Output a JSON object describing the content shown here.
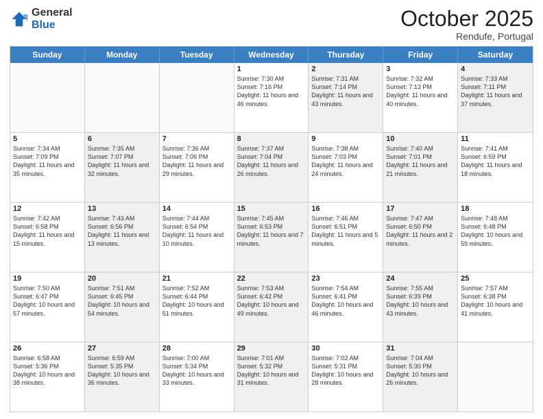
{
  "header": {
    "logo_general": "General",
    "logo_blue": "Blue",
    "month": "October 2025",
    "location": "Rendufe, Portugal"
  },
  "days_of_week": [
    "Sunday",
    "Monday",
    "Tuesday",
    "Wednesday",
    "Thursday",
    "Friday",
    "Saturday"
  ],
  "weeks": [
    [
      {
        "day": "",
        "text": "",
        "shaded": false,
        "empty": true
      },
      {
        "day": "",
        "text": "",
        "shaded": false,
        "empty": true
      },
      {
        "day": "",
        "text": "",
        "shaded": false,
        "empty": true
      },
      {
        "day": "1",
        "text": "Sunrise: 7:30 AM\nSunset: 7:16 PM\nDaylight: 11 hours and 46 minutes.",
        "shaded": false,
        "empty": false
      },
      {
        "day": "2",
        "text": "Sunrise: 7:31 AM\nSunset: 7:14 PM\nDaylight: 11 hours and 43 minutes.",
        "shaded": true,
        "empty": false
      },
      {
        "day": "3",
        "text": "Sunrise: 7:32 AM\nSunset: 7:13 PM\nDaylight: 11 hours and 40 minutes.",
        "shaded": false,
        "empty": false
      },
      {
        "day": "4",
        "text": "Sunrise: 7:33 AM\nSunset: 7:11 PM\nDaylight: 11 hours and 37 minutes.",
        "shaded": true,
        "empty": false
      }
    ],
    [
      {
        "day": "5",
        "text": "Sunrise: 7:34 AM\nSunset: 7:09 PM\nDaylight: 11 hours and 35 minutes.",
        "shaded": false,
        "empty": false
      },
      {
        "day": "6",
        "text": "Sunrise: 7:35 AM\nSunset: 7:07 PM\nDaylight: 11 hours and 32 minutes.",
        "shaded": true,
        "empty": false
      },
      {
        "day": "7",
        "text": "Sunrise: 7:36 AM\nSunset: 7:06 PM\nDaylight: 11 hours and 29 minutes.",
        "shaded": false,
        "empty": false
      },
      {
        "day": "8",
        "text": "Sunrise: 7:37 AM\nSunset: 7:04 PM\nDaylight: 11 hours and 26 minutes.",
        "shaded": true,
        "empty": false
      },
      {
        "day": "9",
        "text": "Sunrise: 7:38 AM\nSunset: 7:03 PM\nDaylight: 11 hours and 24 minutes.",
        "shaded": false,
        "empty": false
      },
      {
        "day": "10",
        "text": "Sunrise: 7:40 AM\nSunset: 7:01 PM\nDaylight: 11 hours and 21 minutes.",
        "shaded": true,
        "empty": false
      },
      {
        "day": "11",
        "text": "Sunrise: 7:41 AM\nSunset: 6:59 PM\nDaylight: 11 hours and 18 minutes.",
        "shaded": false,
        "empty": false
      }
    ],
    [
      {
        "day": "12",
        "text": "Sunrise: 7:42 AM\nSunset: 6:58 PM\nDaylight: 11 hours and 15 minutes.",
        "shaded": false,
        "empty": false
      },
      {
        "day": "13",
        "text": "Sunrise: 7:43 AM\nSunset: 6:56 PM\nDaylight: 11 hours and 13 minutes.",
        "shaded": true,
        "empty": false
      },
      {
        "day": "14",
        "text": "Sunrise: 7:44 AM\nSunset: 6:54 PM\nDaylight: 11 hours and 10 minutes.",
        "shaded": false,
        "empty": false
      },
      {
        "day": "15",
        "text": "Sunrise: 7:45 AM\nSunset: 6:53 PM\nDaylight: 11 hours and 7 minutes.",
        "shaded": true,
        "empty": false
      },
      {
        "day": "16",
        "text": "Sunrise: 7:46 AM\nSunset: 6:51 PM\nDaylight: 11 hours and 5 minutes.",
        "shaded": false,
        "empty": false
      },
      {
        "day": "17",
        "text": "Sunrise: 7:47 AM\nSunset: 6:50 PM\nDaylight: 11 hours and 2 minutes.",
        "shaded": true,
        "empty": false
      },
      {
        "day": "18",
        "text": "Sunrise: 7:48 AM\nSunset: 6:48 PM\nDaylight: 10 hours and 59 minutes.",
        "shaded": false,
        "empty": false
      }
    ],
    [
      {
        "day": "19",
        "text": "Sunrise: 7:50 AM\nSunset: 6:47 PM\nDaylight: 10 hours and 57 minutes.",
        "shaded": false,
        "empty": false
      },
      {
        "day": "20",
        "text": "Sunrise: 7:51 AM\nSunset: 6:45 PM\nDaylight: 10 hours and 54 minutes.",
        "shaded": true,
        "empty": false
      },
      {
        "day": "21",
        "text": "Sunrise: 7:52 AM\nSunset: 6:44 PM\nDaylight: 10 hours and 51 minutes.",
        "shaded": false,
        "empty": false
      },
      {
        "day": "22",
        "text": "Sunrise: 7:53 AM\nSunset: 6:42 PM\nDaylight: 10 hours and 49 minutes.",
        "shaded": true,
        "empty": false
      },
      {
        "day": "23",
        "text": "Sunrise: 7:54 AM\nSunset: 6:41 PM\nDaylight: 10 hours and 46 minutes.",
        "shaded": false,
        "empty": false
      },
      {
        "day": "24",
        "text": "Sunrise: 7:55 AM\nSunset: 6:39 PM\nDaylight: 10 hours and 43 minutes.",
        "shaded": true,
        "empty": false
      },
      {
        "day": "25",
        "text": "Sunrise: 7:57 AM\nSunset: 6:38 PM\nDaylight: 10 hours and 41 minutes.",
        "shaded": false,
        "empty": false
      }
    ],
    [
      {
        "day": "26",
        "text": "Sunrise: 6:58 AM\nSunset: 5:36 PM\nDaylight: 10 hours and 38 minutes.",
        "shaded": false,
        "empty": false
      },
      {
        "day": "27",
        "text": "Sunrise: 6:59 AM\nSunset: 5:35 PM\nDaylight: 10 hours and 36 minutes.",
        "shaded": true,
        "empty": false
      },
      {
        "day": "28",
        "text": "Sunrise: 7:00 AM\nSunset: 5:34 PM\nDaylight: 10 hours and 33 minutes.",
        "shaded": false,
        "empty": false
      },
      {
        "day": "29",
        "text": "Sunrise: 7:01 AM\nSunset: 5:32 PM\nDaylight: 10 hours and 31 minutes.",
        "shaded": true,
        "empty": false
      },
      {
        "day": "30",
        "text": "Sunrise: 7:02 AM\nSunset: 5:31 PM\nDaylight: 10 hours and 28 minutes.",
        "shaded": false,
        "empty": false
      },
      {
        "day": "31",
        "text": "Sunrise: 7:04 AM\nSunset: 5:30 PM\nDaylight: 10 hours and 26 minutes.",
        "shaded": true,
        "empty": false
      },
      {
        "day": "",
        "text": "",
        "shaded": false,
        "empty": true
      }
    ]
  ]
}
